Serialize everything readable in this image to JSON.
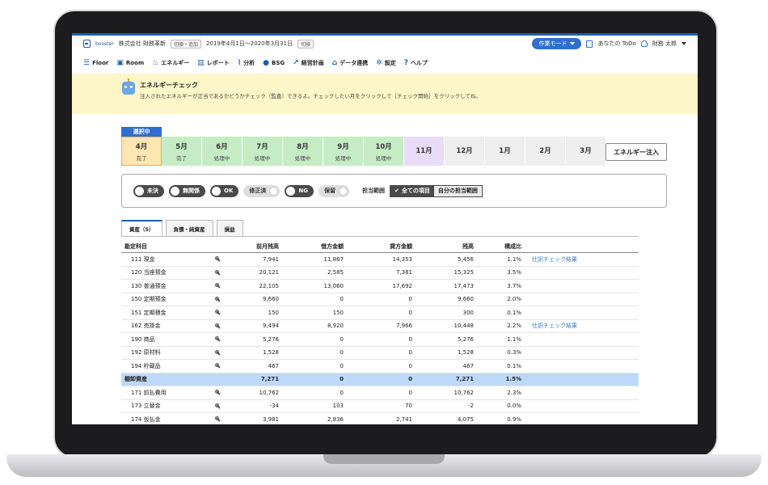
{
  "topbar": {
    "brand": "booster",
    "company": "株式会社 財務革新",
    "switch_tag": "切換・追加",
    "period": "2019年4月1日～2020年3月31日",
    "period_tag": "切換",
    "mode": "作業モード",
    "todo": "あなたの ToDo",
    "user": "財務 太郎"
  },
  "nav": [
    {
      "label": "Floor",
      "icon": "hamburger-icon",
      "glyph": "☰"
    },
    {
      "label": "Room",
      "icon": "room-icon",
      "glyph": "▣"
    },
    {
      "label": "エネルギー",
      "icon": "energy-icon",
      "glyph": "♨"
    },
    {
      "label": "レポート",
      "icon": "report-icon",
      "glyph": "▥"
    },
    {
      "label": "分析",
      "icon": "analysis-icon",
      "glyph": "⌇"
    },
    {
      "label": "BSG",
      "icon": "bsg-icon",
      "glyph": "●"
    },
    {
      "label": "経営計画",
      "icon": "plan-icon",
      "glyph": "↗"
    },
    {
      "label": "データ連携",
      "icon": "link-icon",
      "glyph": "⌂"
    },
    {
      "label": "設定",
      "icon": "gear-icon",
      "glyph": "✲"
    },
    {
      "label": "ヘルプ",
      "icon": "help-icon",
      "glyph": "?"
    }
  ],
  "banner": {
    "title": "エネルギーチェック",
    "text": "注入されたエネルギーが正当であるかどうかチェック（監査）できるよ。チェックしたい月をクリックして［チェック開始］をクリックしてね。"
  },
  "selected_label": "選択中",
  "months": [
    {
      "label": "4月",
      "status": "完了",
      "state": "done"
    },
    {
      "label": "5月",
      "status": "完了",
      "state": "green"
    },
    {
      "label": "6月",
      "status": "処理中",
      "state": "green"
    },
    {
      "label": "7月",
      "status": "処理中",
      "state": "green"
    },
    {
      "label": "8月",
      "status": "処理中",
      "state": "green"
    },
    {
      "label": "9月",
      "status": "処理中",
      "state": "green"
    },
    {
      "label": "10月",
      "status": "処理中",
      "state": "green"
    },
    {
      "label": "11月",
      "status": "",
      "state": "purple"
    },
    {
      "label": "12月",
      "status": "",
      "state": "none"
    },
    {
      "label": "1月",
      "status": "",
      "state": "none"
    },
    {
      "label": "2月",
      "status": "",
      "state": "none"
    },
    {
      "label": "3月",
      "status": "",
      "state": "none"
    }
  ],
  "inject_button": "エネルギー注入",
  "filters": {
    "toggles": [
      {
        "label": "未決",
        "style": "dark"
      },
      {
        "label": "無関係",
        "style": "dark"
      },
      {
        "label": "OK",
        "style": "dark"
      },
      {
        "label": "修正済",
        "style": "light"
      },
      {
        "label": "NG",
        "style": "dark"
      },
      {
        "label": "保留",
        "style": "light"
      }
    ],
    "scope_label": "担当範囲",
    "scope_all": "全ての項目",
    "scope_mine": "自分の担当範囲"
  },
  "report_tabs": [
    "資産（5）",
    "負債・純資産",
    "損益"
  ],
  "table": {
    "headers": {
      "name": "勘定科目",
      "prev": "前月残高",
      "debit": "借方金額",
      "credit": "貸方金額",
      "balance": "残高",
      "ratio": "構成比"
    },
    "rows": [
      {
        "name": "111 現金",
        "prev": "7,941",
        "debit": "11,867",
        "credit": "14,353",
        "balance": "5,456",
        "ratio": "1.1%",
        "link": "仕訳チェック結果",
        "tool": true
      },
      {
        "name": "120 当座預金",
        "prev": "20,121",
        "debit": "2,585",
        "credit": "7,381",
        "balance": "15,325",
        "ratio": "3.5%",
        "link": "",
        "tool": true
      },
      {
        "name": "130 普通預金",
        "prev": "22,105",
        "debit": "13,060",
        "credit": "17,692",
        "balance": "17,473",
        "ratio": "3.7%",
        "link": "",
        "tool": true
      },
      {
        "name": "150 定期預金",
        "prev": "9,660",
        "debit": "0",
        "credit": "0",
        "balance": "9,660",
        "ratio": "2.0%",
        "link": "",
        "tool": true
      },
      {
        "name": "151 定期積金",
        "prev": "150",
        "debit": "150",
        "credit": "0",
        "balance": "300",
        "ratio": "0.1%",
        "link": "",
        "tool": true
      },
      {
        "name": "162 売掛金",
        "prev": "9,494",
        "debit": "8,920",
        "credit": "7,966",
        "balance": "10,448",
        "ratio": "2.2%",
        "link": "仕訳チェック結果",
        "tool": true
      },
      {
        "name": "190 商品",
        "prev": "5,276",
        "debit": "0",
        "credit": "0",
        "balance": "5,276",
        "ratio": "1.1%",
        "link": "",
        "tool": true
      },
      {
        "name": "192 原材料",
        "prev": "1,528",
        "debit": "0",
        "credit": "0",
        "balance": "1,528",
        "ratio": "0.3%",
        "link": "",
        "tool": true
      },
      {
        "name": "194 貯蔵品",
        "prev": "467",
        "debit": "0",
        "credit": "0",
        "balance": "467",
        "ratio": "0.1%",
        "link": "",
        "tool": true
      },
      {
        "name": "棚卸資産",
        "prev": "7,271",
        "debit": "0",
        "credit": "0",
        "balance": "7,271",
        "ratio": "1.5%",
        "link": "",
        "tool": false,
        "subtotal": true
      },
      {
        "name": "171 前払費用",
        "prev": "10,762",
        "debit": "0",
        "credit": "0",
        "balance": "10,762",
        "ratio": "2.3%",
        "link": "",
        "tool": true
      },
      {
        "name": "173 立替金",
        "prev": "-34",
        "debit": "103",
        "credit": "70",
        "balance": "-2",
        "ratio": "0.0%",
        "link": "",
        "tool": true
      },
      {
        "name": "174 仮払金",
        "prev": "3,981",
        "debit": "2,836",
        "credit": "2,741",
        "balance": "4,075",
        "ratio": "0.9%",
        "link": "",
        "tool": true
      }
    ]
  }
}
